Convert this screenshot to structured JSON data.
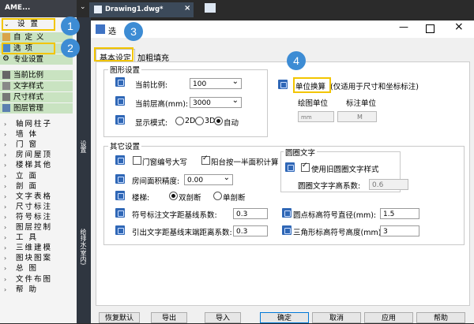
{
  "palette": {
    "title": "AME...",
    "menu": "设 置",
    "sub1": "自 定 义",
    "sub2": "选 项",
    "sub3": "专业设置",
    "cats": [
      "当前比例",
      "文字样式",
      "尺寸样式",
      "图层管理"
    ],
    "items": [
      "轴网柱子",
      "墙 体",
      "门 窗",
      "房间屋顶",
      "楼梯其他",
      "立 面",
      "剖 面",
      "文字表格",
      "尺寸标注",
      "符号标注",
      "图层控制",
      "工 具",
      "三维建模",
      "图块图案",
      "总 图",
      "文件布图",
      "帮 助"
    ],
    "strip_label": "设置",
    "strip_label2": "给排水(室内)"
  },
  "doc_tab": "Drawing1.dwg*",
  "dialog": {
    "title": "选",
    "tabs": [
      "基本设定",
      "加粗填充"
    ],
    "grp_graphic": "图形设置",
    "scale_label": "当前比例:",
    "scale_value": "100",
    "height_label": "当前层高(mm):",
    "height_value": "3000",
    "display_label": "显示模式:",
    "mode_2d": "2D",
    "mode_3d": "3D",
    "mode_auto": "自动",
    "unit_label": "单位换算",
    "unit_note": "(仅适用于尺寸和坐标标注)",
    "draw_unit": "绘图单位",
    "mark_unit": "标注单位",
    "draw_unit_value": "mm",
    "mark_unit_value": "M",
    "grp_other": "其它设置",
    "door_upper": "门窗编号大写",
    "balcony": "阳台按一半面积计算",
    "area_label": "房间面积精度:",
    "area_value": "0.00",
    "stair_label": "楼梯:",
    "stair_double": "双剖断",
    "stair_single": "单剖断",
    "sym_dist_label": "符号标注文字距基线系数:",
    "sym_dist_value": "0.3",
    "lead_dist_label": "引出文字距基线末端距离系数:",
    "lead_dist_value": "0.3",
    "grp_circle": "圆圈文字",
    "circle_old": "使用旧圆圈文字样式",
    "circle_ratio_label": "圆圈文字字高系数:",
    "circle_ratio_value": "0.6",
    "dot_diam_label": "圆点标高符号直径(mm):",
    "dot_diam_value": "1.5",
    "tri_height_label": "三角形标高符号高度(mm):",
    "tri_height_value": "3",
    "buttons": [
      "恢复默认",
      "导出",
      "导入",
      "确定",
      "取消",
      "应用",
      "帮助"
    ]
  },
  "badges": [
    "1",
    "2",
    "3",
    "4"
  ]
}
